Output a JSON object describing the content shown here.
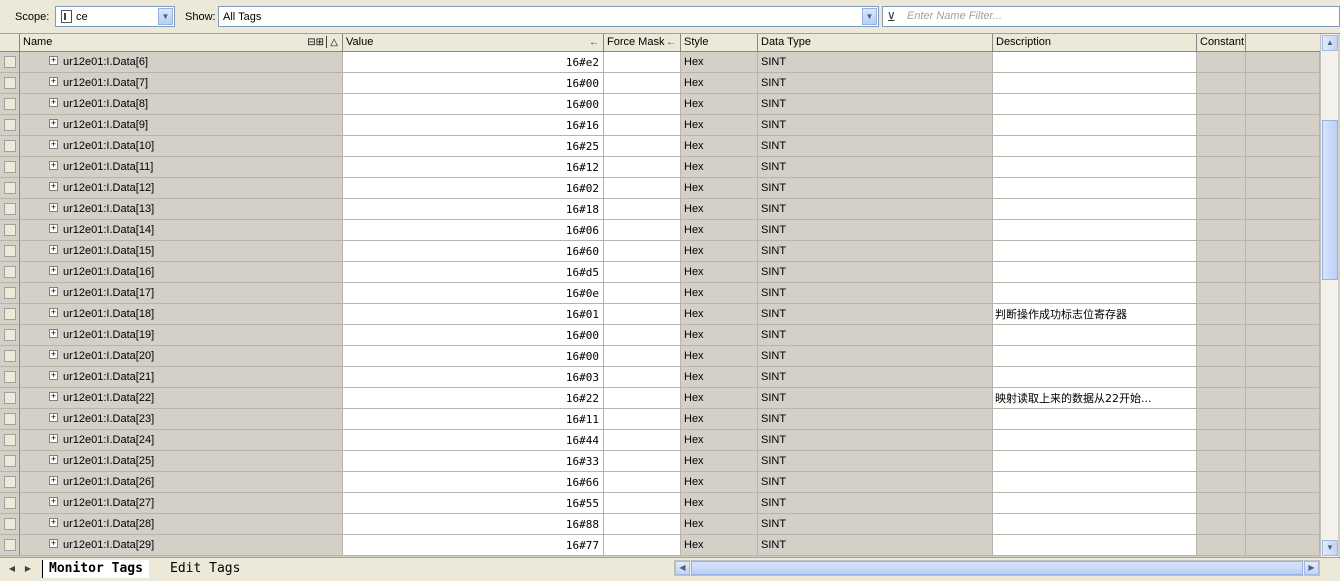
{
  "toolbar": {
    "scope_label": "Scope:",
    "scope_value": "ce",
    "show_label": "Show:",
    "show_value": "All Tags",
    "filter_placeholder": "Enter Name Filter..."
  },
  "columns": {
    "name": "Name",
    "value": "Value",
    "force_mask": "Force Mask",
    "style": "Style",
    "data_type": "Data Type",
    "description": "Description",
    "constant": "Constant"
  },
  "rows": [
    {
      "name": "ur12e01:I.Data[6]",
      "value": "16#e2",
      "style": "Hex",
      "type": "SINT",
      "desc": ""
    },
    {
      "name": "ur12e01:I.Data[7]",
      "value": "16#00",
      "style": "Hex",
      "type": "SINT",
      "desc": ""
    },
    {
      "name": "ur12e01:I.Data[8]",
      "value": "16#00",
      "style": "Hex",
      "type": "SINT",
      "desc": ""
    },
    {
      "name": "ur12e01:I.Data[9]",
      "value": "16#16",
      "style": "Hex",
      "type": "SINT",
      "desc": ""
    },
    {
      "name": "ur12e01:I.Data[10]",
      "value": "16#25",
      "style": "Hex",
      "type": "SINT",
      "desc": ""
    },
    {
      "name": "ur12e01:I.Data[11]",
      "value": "16#12",
      "style": "Hex",
      "type": "SINT",
      "desc": ""
    },
    {
      "name": "ur12e01:I.Data[12]",
      "value": "16#02",
      "style": "Hex",
      "type": "SINT",
      "desc": ""
    },
    {
      "name": "ur12e01:I.Data[13]",
      "value": "16#18",
      "style": "Hex",
      "type": "SINT",
      "desc": ""
    },
    {
      "name": "ur12e01:I.Data[14]",
      "value": "16#06",
      "style": "Hex",
      "type": "SINT",
      "desc": ""
    },
    {
      "name": "ur12e01:I.Data[15]",
      "value": "16#60",
      "style": "Hex",
      "type": "SINT",
      "desc": ""
    },
    {
      "name": "ur12e01:I.Data[16]",
      "value": "16#d5",
      "style": "Hex",
      "type": "SINT",
      "desc": ""
    },
    {
      "name": "ur12e01:I.Data[17]",
      "value": "16#0e",
      "style": "Hex",
      "type": "SINT",
      "desc": ""
    },
    {
      "name": "ur12e01:I.Data[18]",
      "value": "16#01",
      "style": "Hex",
      "type": "SINT",
      "desc": "判断操作成功标志位寄存器"
    },
    {
      "name": "ur12e01:I.Data[19]",
      "value": "16#00",
      "style": "Hex",
      "type": "SINT",
      "desc": ""
    },
    {
      "name": "ur12e01:I.Data[20]",
      "value": "16#00",
      "style": "Hex",
      "type": "SINT",
      "desc": ""
    },
    {
      "name": "ur12e01:I.Data[21]",
      "value": "16#03",
      "style": "Hex",
      "type": "SINT",
      "desc": ""
    },
    {
      "name": "ur12e01:I.Data[22]",
      "value": "16#22",
      "style": "Hex",
      "type": "SINT",
      "desc": "映射读取上来的数据从22开始..."
    },
    {
      "name": "ur12e01:I.Data[23]",
      "value": "16#11",
      "style": "Hex",
      "type": "SINT",
      "desc": ""
    },
    {
      "name": "ur12e01:I.Data[24]",
      "value": "16#44",
      "style": "Hex",
      "type": "SINT",
      "desc": ""
    },
    {
      "name": "ur12e01:I.Data[25]",
      "value": "16#33",
      "style": "Hex",
      "type": "SINT",
      "desc": ""
    },
    {
      "name": "ur12e01:I.Data[26]",
      "value": "16#66",
      "style": "Hex",
      "type": "SINT",
      "desc": ""
    },
    {
      "name": "ur12e01:I.Data[27]",
      "value": "16#55",
      "style": "Hex",
      "type": "SINT",
      "desc": ""
    },
    {
      "name": "ur12e01:I.Data[28]",
      "value": "16#88",
      "style": "Hex",
      "type": "SINT",
      "desc": ""
    },
    {
      "name": "ur12e01:I.Data[29]",
      "value": "16#77",
      "style": "Hex",
      "type": "SINT",
      "desc": ""
    }
  ],
  "tabs": {
    "monitor": "Monitor Tags",
    "edit": "Edit Tags"
  },
  "icons": {
    "expand": "plus-icon",
    "sort": "sort-ascending-icon",
    "filter": "funnel-icon"
  }
}
